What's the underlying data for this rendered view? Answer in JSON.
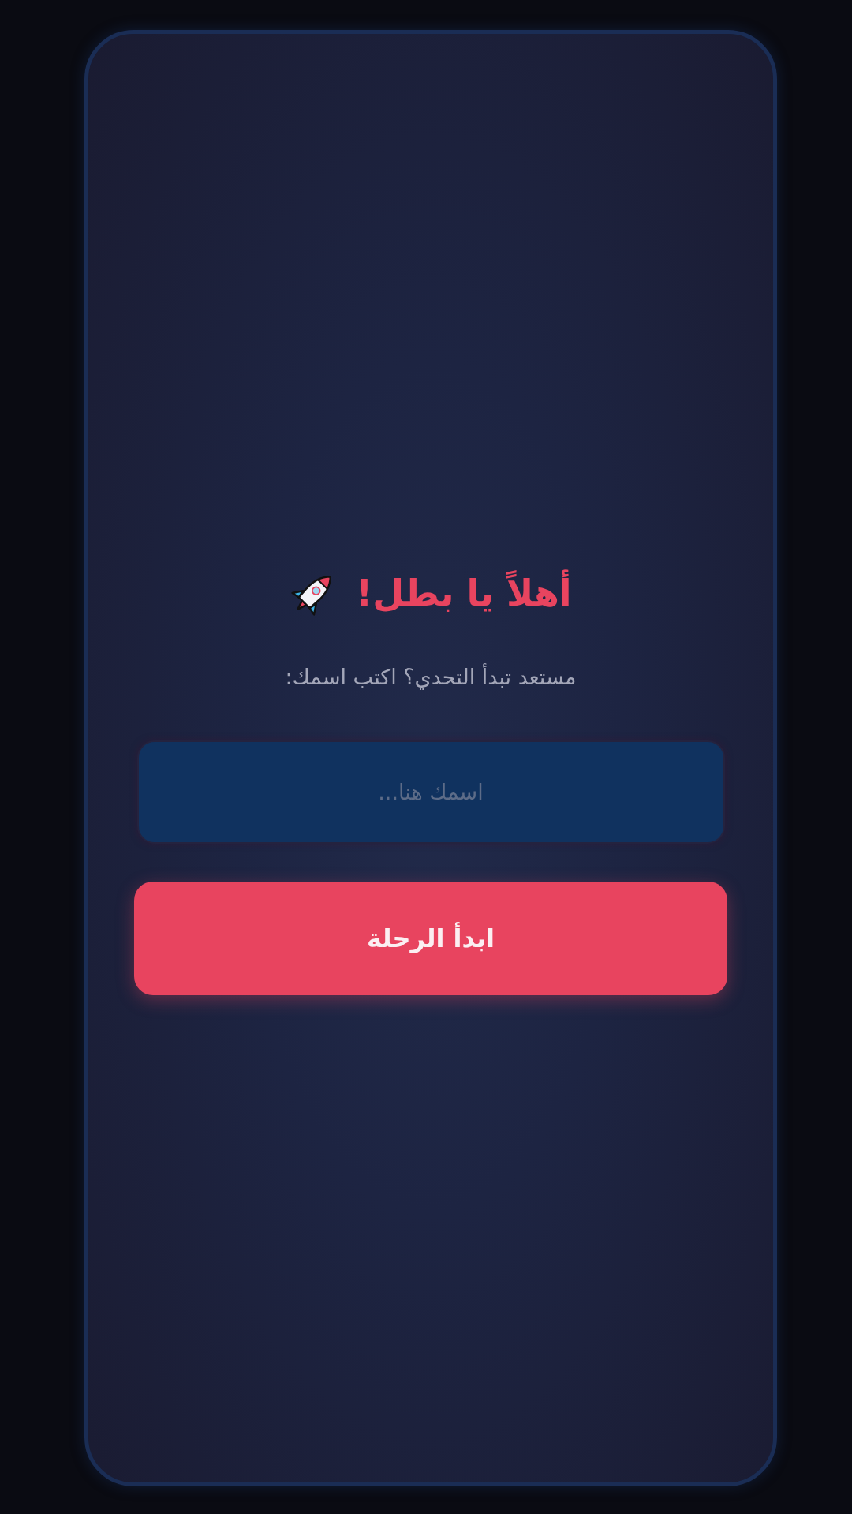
{
  "card": {
    "title": "أهلاً يا بطل!",
    "subtitle": "مستعد تبدأ التحدي؟ اكتب اسمك:",
    "name_field": {
      "placeholder": "اسمك هنا..."
    },
    "start_button": {
      "label": "ابدأ الرحلة"
    }
  }
}
